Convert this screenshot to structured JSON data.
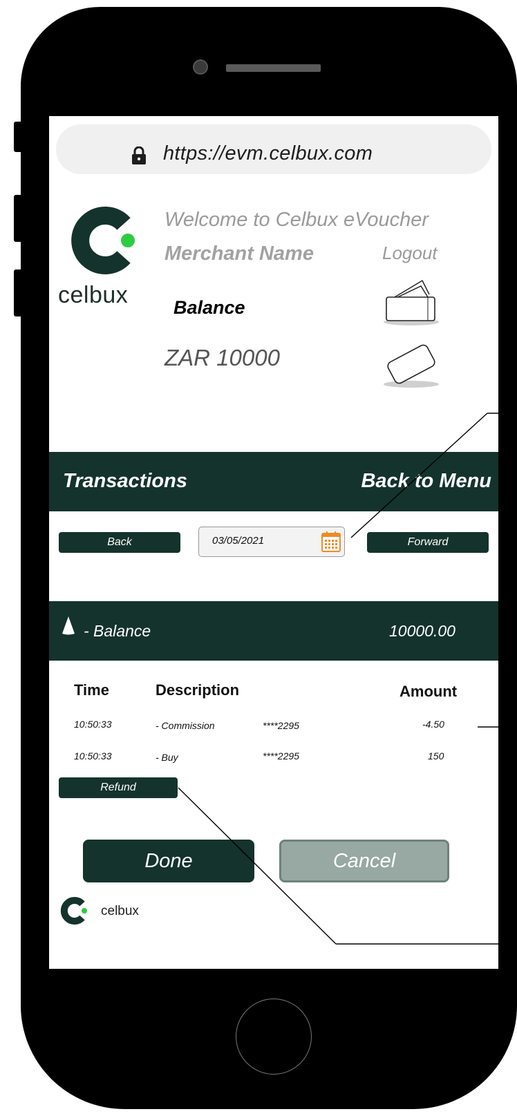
{
  "browser": {
    "url": "https://evm.celbux.com"
  },
  "header": {
    "logo_text": "celbux",
    "welcome": "Welcome to Celbux eVoucher",
    "merchant_name": "Merchant Name",
    "logout": "Logout",
    "balance_label": "Balance",
    "balance_value": "ZAR 10000"
  },
  "transactions_bar": {
    "title": "Transactions",
    "back_to_menu": "Back to Menu"
  },
  "date_nav": {
    "back": "Back",
    "date": "03/05/2021",
    "forward": "Forward"
  },
  "balance_bar": {
    "label": "- Balance",
    "amount": "10000.00"
  },
  "table": {
    "headers": {
      "time": "Time",
      "description": "Description",
      "amount": "Amount"
    },
    "rows": [
      {
        "time": "10:50:33",
        "description": "- Commission",
        "card": "****2295",
        "amount": "-4.50"
      },
      {
        "time": "10:50:33",
        "description": "- Buy",
        "card": "****2295",
        "amount": "150"
      }
    ],
    "refund": "Refund"
  },
  "actions": {
    "done": "Done",
    "cancel": "Cancel"
  },
  "footer": {
    "logo_text": "celbux"
  },
  "colors": {
    "primary": "#14332c",
    "accent_green": "#2ecc40",
    "calendar_orange": "#f08a24",
    "cancel_bg": "#98a8a2"
  },
  "icons": {
    "lock": "lock-icon",
    "wallet": "wallet-icon",
    "card": "card-icon",
    "calendar": "calendar-icon",
    "expand": "triangle-icon"
  }
}
